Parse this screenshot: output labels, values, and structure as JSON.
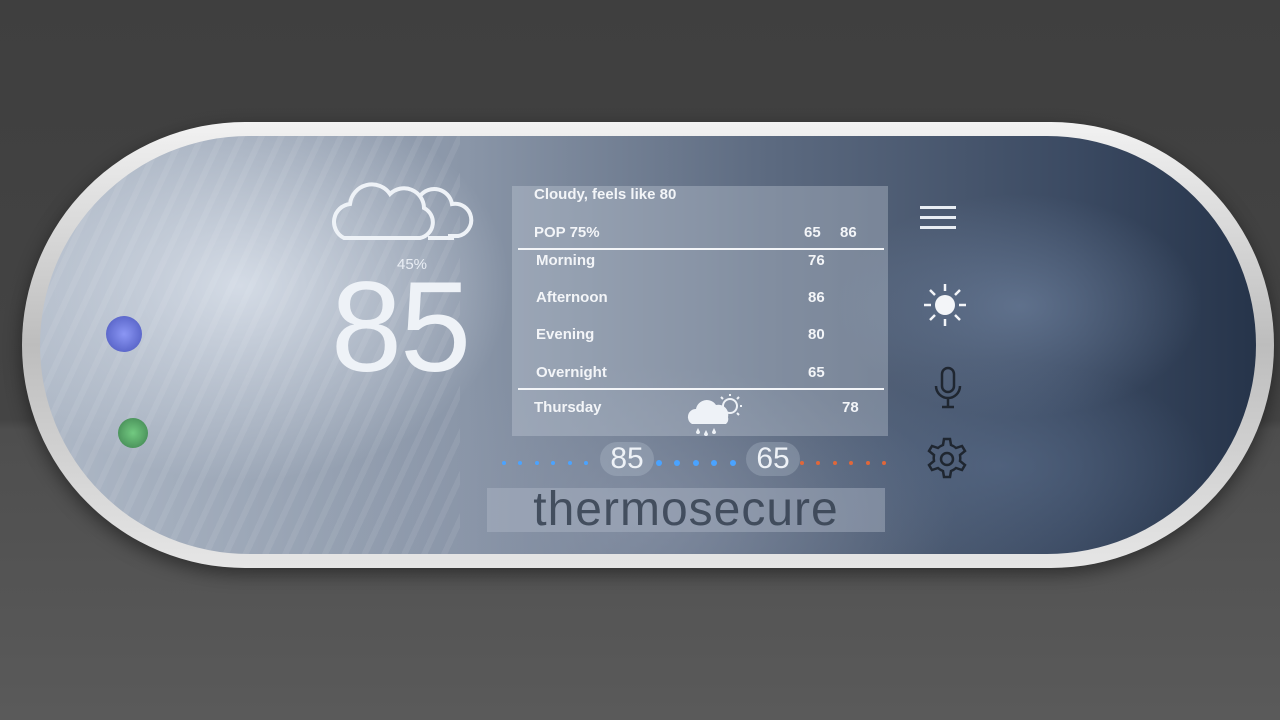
{
  "current": {
    "humidity": "45%",
    "temperature": "85"
  },
  "forecast": {
    "summary": "Cloudy, feels like 80",
    "pop_label": "POP 75%",
    "pop_low": "65",
    "pop_high": "86",
    "periods": [
      {
        "label": "Morning",
        "value": "76"
      },
      {
        "label": "Afternoon",
        "value": "86"
      },
      {
        "label": "Evening",
        "value": "80"
      },
      {
        "label": "Overnight",
        "value": "65"
      }
    ],
    "next_day": {
      "label": "Thursday",
      "value": "78",
      "icon": "rain-partly-sunny-icon"
    }
  },
  "setpoints": {
    "high": "85",
    "low": "65",
    "colors": {
      "cool": "#4aa3ff",
      "heat": "#e0673a"
    }
  },
  "brand": {
    "name": "thermosecure"
  },
  "icons": {
    "weather": "cloud-icon",
    "menu": "menu-icon",
    "brightness": "sun-icon",
    "voice": "microphone-icon",
    "settings": "gear-icon"
  }
}
